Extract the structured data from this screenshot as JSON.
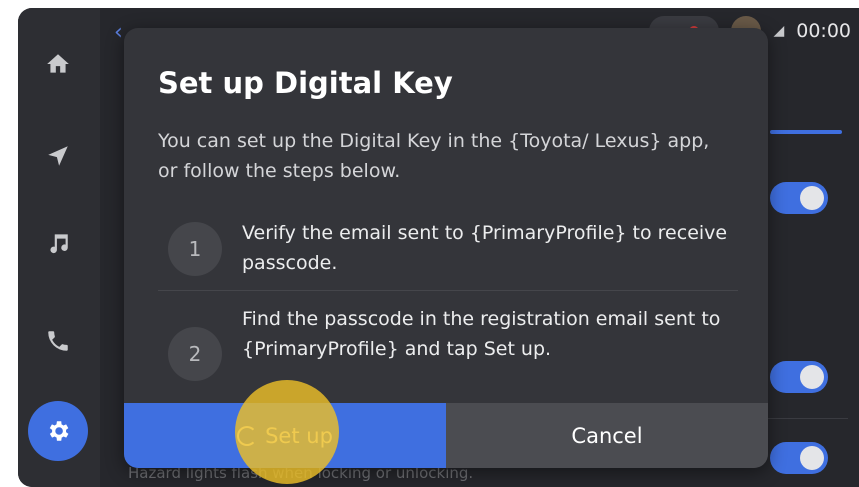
{
  "status": {
    "clock": "00:00",
    "signal_icon": "signal-icon"
  },
  "nav": {
    "items": [
      {
        "name": "home",
        "icon": "home-icon"
      },
      {
        "name": "navigation",
        "icon": "navigation-arrow-icon"
      },
      {
        "name": "music",
        "icon": "music-note-icon"
      },
      {
        "name": "phone",
        "icon": "phone-icon"
      },
      {
        "name": "settings",
        "icon": "gear-icon"
      }
    ],
    "active": "settings"
  },
  "background": {
    "caption": "Hazard lights flash when locking or unlocking."
  },
  "dialog": {
    "title": "Set up Digital Key",
    "description": "You can set up the Digital Key in the {Toyota/ Lexus} app, or follow the steps below.",
    "steps": [
      {
        "number": "1",
        "text": "Verify the email sent to {PrimaryProfile} to receive passcode."
      },
      {
        "number": "2",
        "text": "Find the passcode in the registration email sent to {PrimaryProfile} and tap Set up."
      }
    ],
    "primary_button": "Set up",
    "secondary_button": "Cancel"
  },
  "colors": {
    "accent": "#3f6fe0",
    "dialog_bg": "#34353a",
    "screen_bg": "#26272c",
    "tap_highlight": "#ecbe28"
  }
}
